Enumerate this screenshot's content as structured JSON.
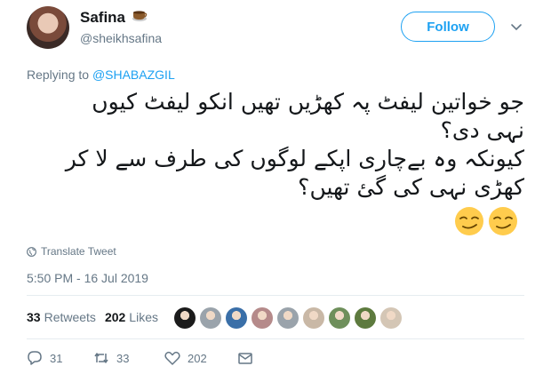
{
  "user": {
    "name": "Safina",
    "handle": "@sheikhsafina",
    "name_emoji": "teacup-emoji"
  },
  "follow_label": "Follow",
  "reply": {
    "prefix": "Replying to",
    "mention": "@SHABAZGIL"
  },
  "tweet": {
    "lines": [
      "جو خواتین لیفٹ پہ کھڑیں تھیں انکو لیفٹ کیوں",
      "نہی دی؟",
      "کیونکہ وہ بےچاری اپکے لوگوں کی طرف سے لا کر",
      "کھڑی نہی کی گئ تھیں؟"
    ],
    "emojis": [
      "smirk-emoji",
      "smirk-emoji"
    ]
  },
  "translate_label": "Translate Tweet",
  "timestamp": "5:50 PM - 16 Jul 2019",
  "stats": {
    "retweets_count": "33",
    "retweets_label": "Retweets",
    "likes_count": "202",
    "likes_label": "Likes"
  },
  "likers": [
    "#1b1b1b",
    "#9aa3ab",
    "#3a6fa8",
    "#b58a8a",
    "#9aa3ab",
    "#c9b8a6",
    "#6e8f5b",
    "#5d7a3e",
    "#d4c6b5"
  ],
  "actions": {
    "reply_count": "31",
    "retweet_count": "33",
    "like_count": "202"
  },
  "colors": {
    "accent": "#1da1f2",
    "secondary_text": "#657786"
  }
}
